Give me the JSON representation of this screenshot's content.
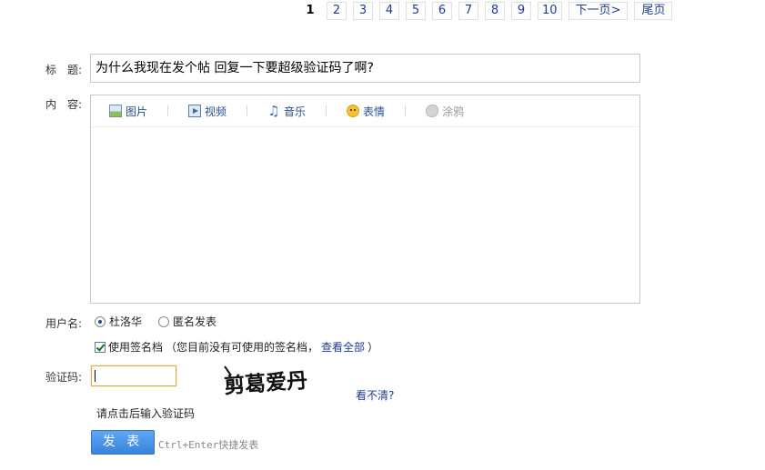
{
  "pagination": {
    "pages": [
      "1",
      "2",
      "3",
      "4",
      "5",
      "6",
      "7",
      "8",
      "9",
      "10"
    ],
    "current": "1",
    "next_label": "下一页>",
    "last_label": "尾页"
  },
  "form": {
    "title_label": "标　题:",
    "title_value": "为什么我现在发个帖 回复一下要超级验证码了啊?",
    "content_label": "内　容:",
    "toolbar": {
      "picture": "图片",
      "video": "视频",
      "music": "音乐",
      "emoticon": "表情",
      "graffiti": "涂鸦"
    },
    "username_label": "用户名:",
    "username_option": "杜洛华",
    "anonymous_option": "匿名发表",
    "signature_label": "使用签名档",
    "signature_note": "（您目前没有可使用的签名档，",
    "signature_link": "查看全部",
    "signature_end": "）",
    "captcha_label": "验证码:",
    "captcha_text": "剪葛爱丹",
    "captcha_refresh": "看不清?",
    "captcha_hint": "请点击后输入验证码",
    "submit_label": "发 表",
    "shortcut_hint": "Ctrl+Enter快捷发表"
  }
}
